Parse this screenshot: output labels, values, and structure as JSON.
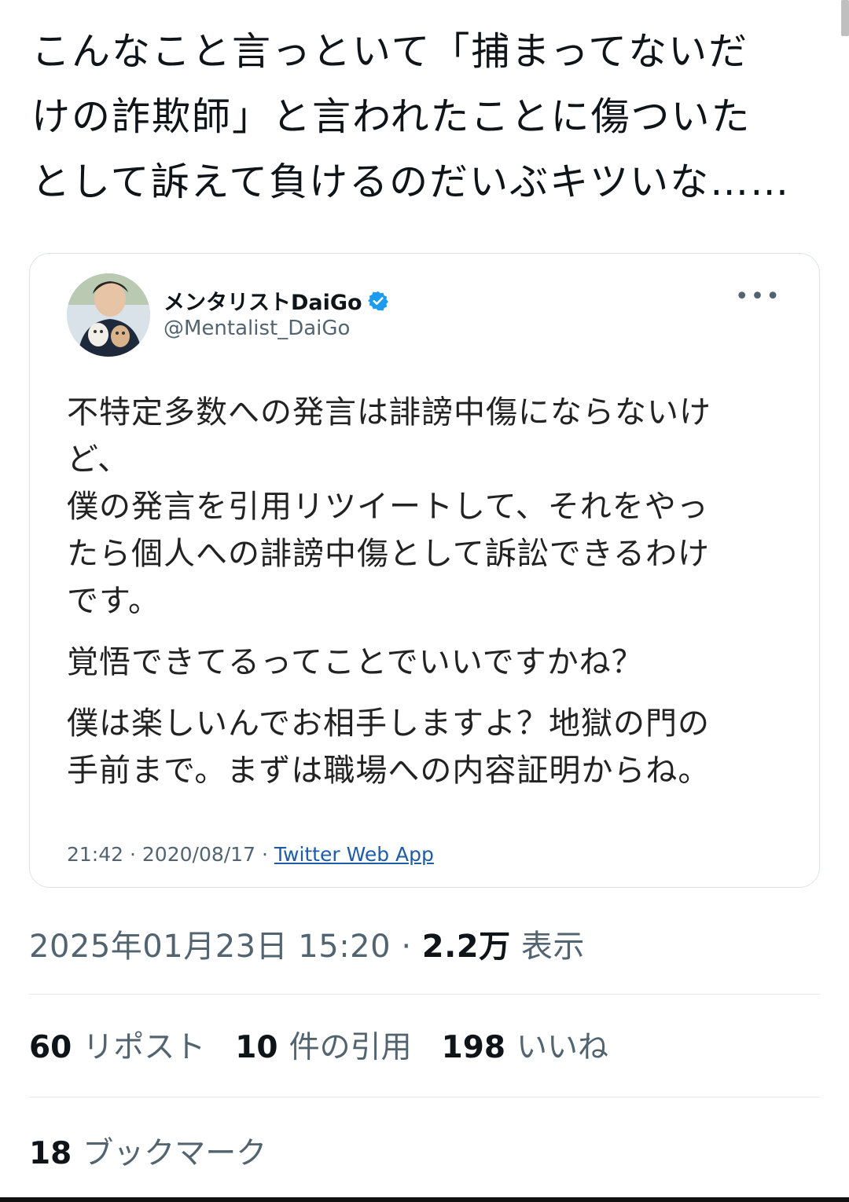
{
  "post": {
    "text_lines": [
      "こんなこと言っといて「捕まってないだ",
      "けの詐欺師」と言われたことに傷ついた",
      "として訴えて負けるのだいぶキツいな……"
    ]
  },
  "quoted_tweet": {
    "display_name": "メンタリストDaiGo",
    "handle": "@Mentalist_DaiGo",
    "paragraphs": [
      "不特定多数への発言は誹謗中傷にならないけ\nど、\n僕の発言を引用リツイートして、それをやっ\nたら個人への誹謗中傷として訴訟できるわけ\nです。",
      "覚悟できてるってことでいいですかね？",
      "僕は楽しいんでお相手しますよ？地獄の門の\n手前まで。まずは職場への内容証明からね。"
    ],
    "time": "21:42",
    "date": "2020/08/17",
    "source": "Twitter Web App"
  },
  "meta": {
    "timestamp": "2025年01月23日 15:20",
    "separator": "·",
    "views_count": "2.2万",
    "views_label": "表示"
  },
  "stats": {
    "reposts_count": "60",
    "reposts_label": "リポスト",
    "quotes_count": "10",
    "quotes_label": "件の引用",
    "likes_count": "198",
    "likes_label": "いいね",
    "bookmarks_count": "18",
    "bookmarks_label": "ブックマーク"
  },
  "colors": {
    "verified_blue": "#1d9bf0",
    "link_blue": "#1d5ca8",
    "muted_gray": "#536471"
  },
  "icons": [
    "verified-badge-icon",
    "more-options-icon",
    "avatar-photo"
  ]
}
